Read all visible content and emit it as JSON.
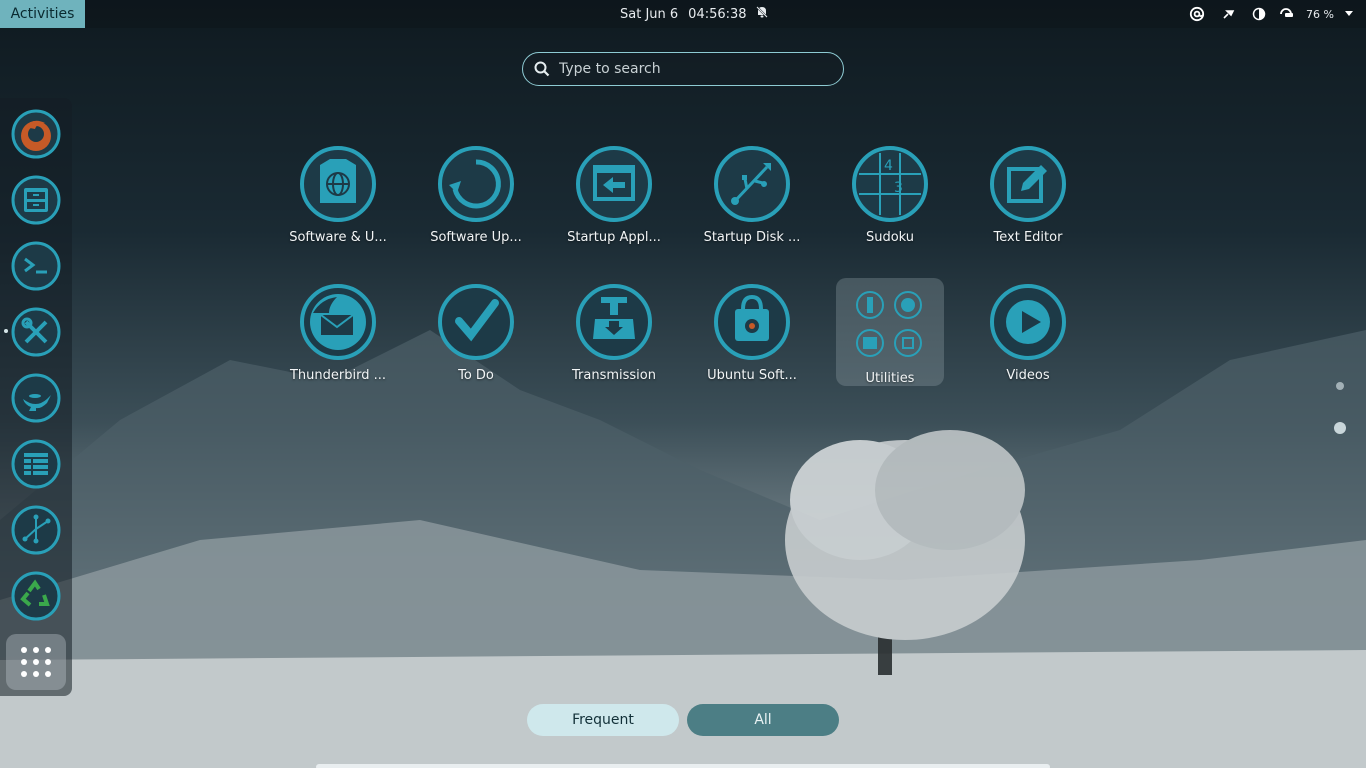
{
  "colors": {
    "accent": "#29a0b8",
    "icon_dark": "#1d3a47",
    "tab_active": "#cfe8ec",
    "tab_inactive": "#4c7e85"
  },
  "topbar": {
    "activities_label": "Activities",
    "date": "Sat Jun 6",
    "time": "04:56:38",
    "notification_icon": "bell-off-icon",
    "tray_icons": [
      "at-sign-icon",
      "pin-icon",
      "contrast-icon",
      "battery-icon"
    ],
    "battery_percent": "76 %",
    "menu_arrow_icon": "chevron-down-icon"
  },
  "search": {
    "placeholder": "Type to search",
    "icon": "search-icon"
  },
  "dock": {
    "items": [
      {
        "name": "firefox-icon"
      },
      {
        "name": "file-manager-icon"
      },
      {
        "name": "terminal-icon"
      },
      {
        "name": "tools-icon"
      },
      {
        "name": "genie-lamp-icon"
      },
      {
        "name": "spreadsheet-icon"
      },
      {
        "name": "graph-icon"
      },
      {
        "name": "recycle-bin-icon"
      }
    ],
    "show_apps_icon": "grid-dots-icon"
  },
  "apps": [
    {
      "label": "Software & U...",
      "icon": "software-sources-icon"
    },
    {
      "label": "Software Up...",
      "icon": "software-updater-icon"
    },
    {
      "label": "Startup Appl...",
      "icon": "startup-applications-icon"
    },
    {
      "label": "Startup Disk ...",
      "icon": "usb-icon"
    },
    {
      "label": "Sudoku",
      "icon": "sudoku-icon"
    },
    {
      "label": "Text Editor",
      "icon": "text-editor-icon"
    },
    {
      "label": "Thunderbird ...",
      "icon": "thunderbird-icon"
    },
    {
      "label": "To Do",
      "icon": "checkmark-icon"
    },
    {
      "label": "Transmission",
      "icon": "transmission-icon"
    },
    {
      "label": "Ubuntu Soft...",
      "icon": "shopping-bag-icon"
    },
    {
      "label": "Utilities",
      "icon": "folder-icon"
    },
    {
      "label": "Videos",
      "icon": "play-icon"
    }
  ],
  "sudoku_digits": [
    "4",
    "3"
  ],
  "tabs": {
    "frequent": "Frequent",
    "all": "All"
  },
  "pager": {
    "current_page": 2,
    "total_pages": 2
  }
}
